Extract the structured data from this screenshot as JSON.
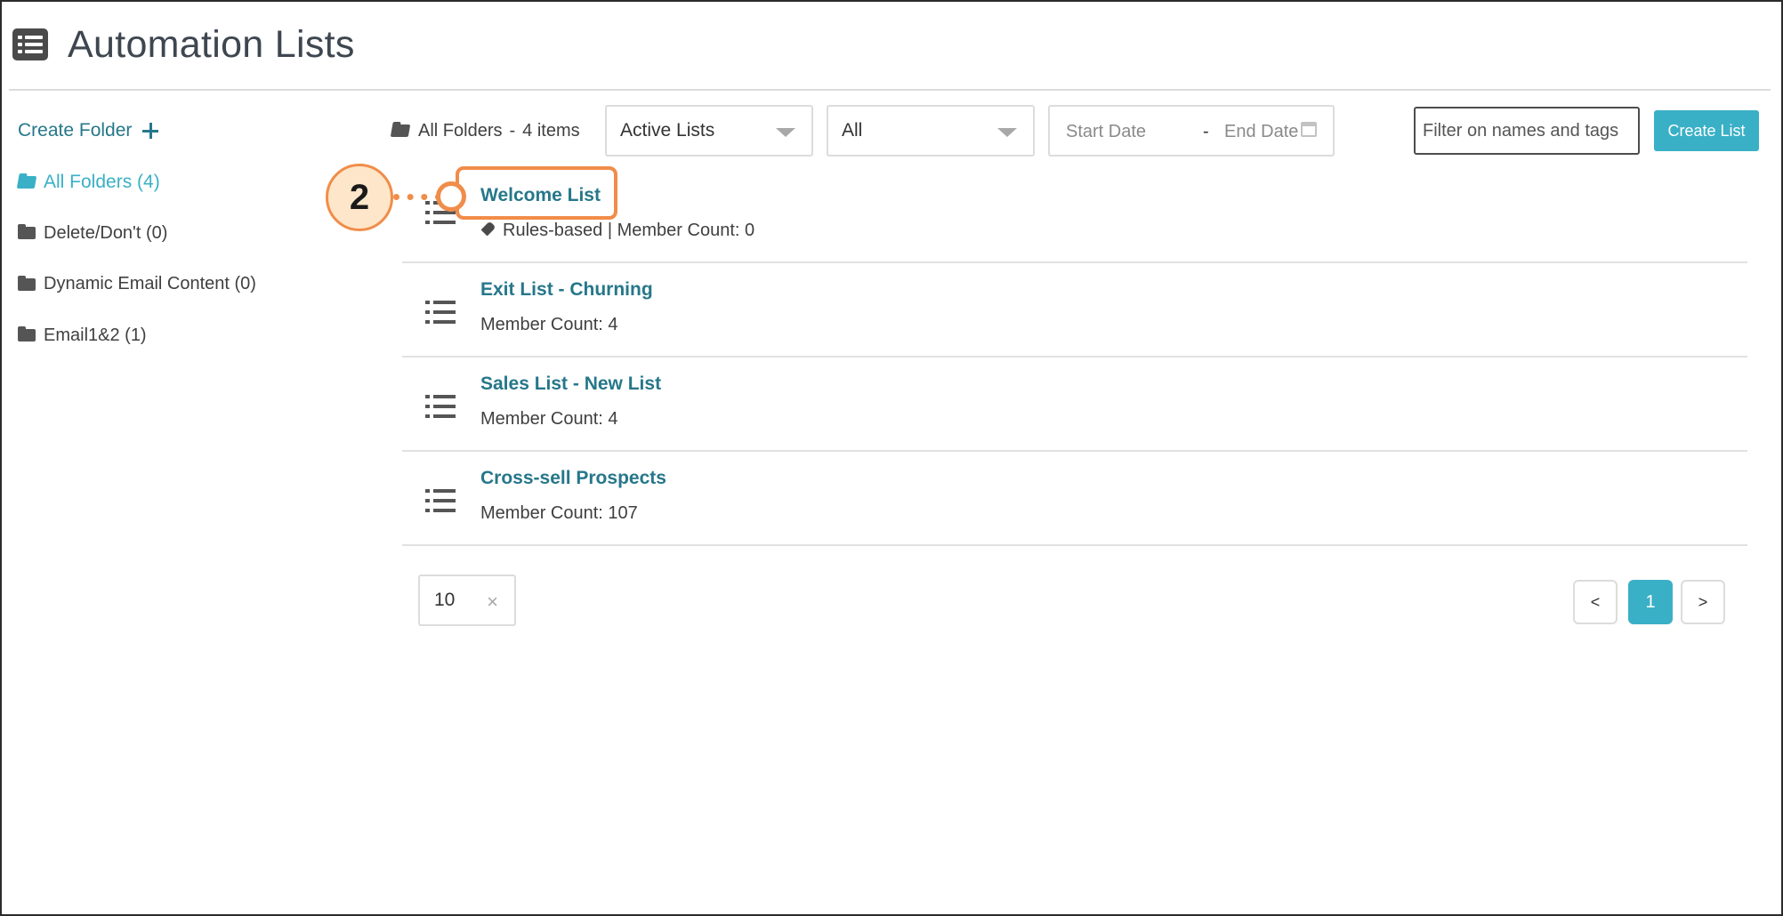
{
  "header": {
    "title": "Automation Lists",
    "icon": "list-icon"
  },
  "sidebar": {
    "create_folder_label": "Create Folder",
    "folders": [
      {
        "label": "All Folders (4)",
        "active": true,
        "icon": "folder-open-icon"
      },
      {
        "label": "Delete/Don't (0)",
        "active": false,
        "icon": "folder-icon"
      },
      {
        "label": "Dynamic Email Content (0)",
        "active": false,
        "icon": "folder-icon"
      },
      {
        "label": "Email1&2 (1)",
        "active": false,
        "icon": "folder-icon"
      }
    ]
  },
  "toolbar": {
    "current_folder": "All Folders",
    "separator": "-",
    "item_count": "4 items",
    "status_select": "Active Lists",
    "type_select": "All",
    "start_date_placeholder": "Start Date",
    "date_separator": "-",
    "end_date_placeholder": "End Date",
    "filter_placeholder": "Filter on names and tags",
    "create_list_label": "Create List"
  },
  "lists": [
    {
      "title": "Welcome List",
      "meta": "Rules-based | Member Count: 0",
      "tag_icon": true
    },
    {
      "title": "Exit List - Churning",
      "meta": "Member Count: 4",
      "tag_icon": false
    },
    {
      "title": "Sales List - New List",
      "meta": "Member Count: 4",
      "tag_icon": false
    },
    {
      "title": "Cross-sell Prospects",
      "meta": "Member Count: 107",
      "tag_icon": false
    }
  ],
  "pagination": {
    "page_size": "10",
    "clear_symbol": "×",
    "prev_label": "<",
    "current_page": "1",
    "next_label": ">"
  },
  "annotation": {
    "step_number": "2"
  },
  "colors": {
    "accent": "#3ab0c6",
    "link": "#26778a",
    "callout": "#f08d4a"
  }
}
